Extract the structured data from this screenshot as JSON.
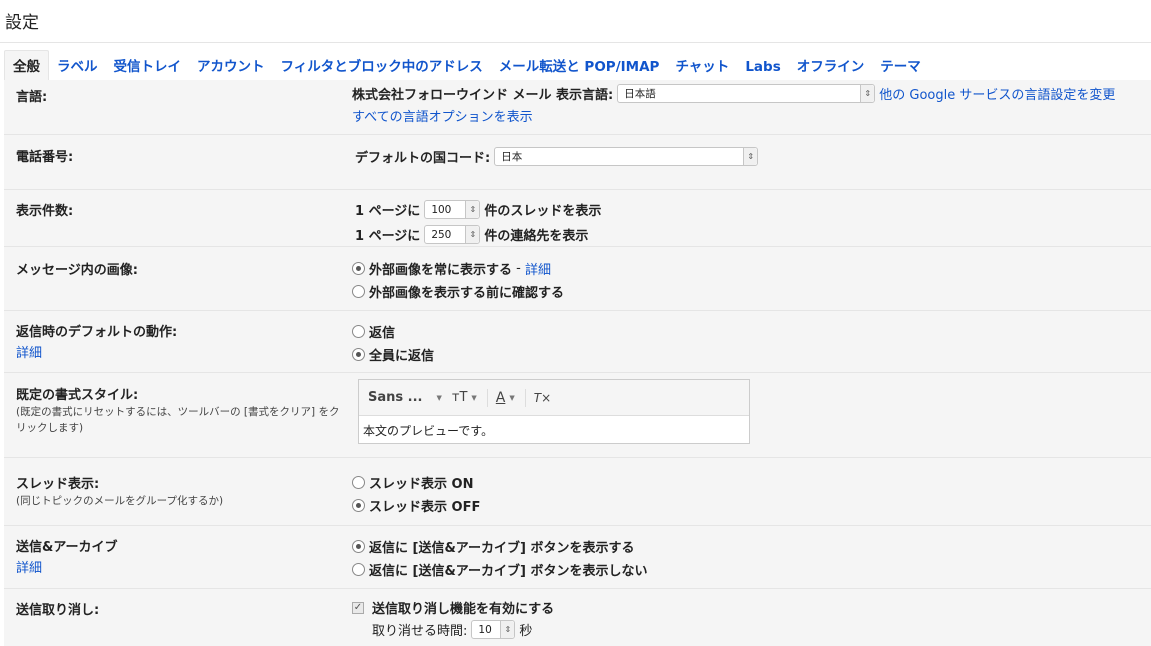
{
  "page_title": "設定",
  "tabs": [
    "全般",
    "ラベル",
    "受信トレイ",
    "アカウント",
    "フィルタとブロック中のアドレス",
    "メール転送と POP/IMAP",
    "チャット",
    "Labs",
    "オフライン",
    "テーマ"
  ],
  "language": {
    "label": "言語:",
    "prefix": "株式会社フォローウインド メール 表示言語:",
    "selected": "日本語",
    "other_link": "他の Google サービスの言語設定を変更",
    "all_options_link": "すべての言語オプションを表示"
  },
  "phone": {
    "label": "電話番号:",
    "prefix": "デフォルトの国コード:",
    "selected": "日本"
  },
  "display_count": {
    "label": "表示件数:",
    "threads_prefix": "1 ページに",
    "threads_value": "100",
    "threads_suffix": "件のスレッドを表示",
    "contacts_prefix": "1 ページに",
    "contacts_value": "250",
    "contacts_suffix": "件の連絡先を表示"
  },
  "images": {
    "label": "メッセージ内の画像:",
    "option_always": "外部画像を常に表示する",
    "separator": " - ",
    "detail_link": "詳細",
    "option_ask": "外部画像を表示する前に確認する"
  },
  "reply": {
    "label": "返信時のデフォルトの動作:",
    "detail_link": "詳細",
    "option_reply": "返信",
    "option_reply_all": "全員に返信"
  },
  "text_style": {
    "label": "既定の書式スタイル:",
    "note": "(既定の書式にリセットするには、ツールバーの [書式をクリア] をクリックします)",
    "font_name": "Sans ...",
    "size_icon_text": "ᴛT",
    "color_icon_text": "A",
    "clear_icon_text": "T×",
    "preview": "本文のプレビューです。"
  },
  "threads": {
    "label": "スレッド表示:",
    "note": "(同じトピックのメールをグループ化するか)",
    "option_on": "スレッド表示 ON",
    "option_off": "スレッド表示 OFF"
  },
  "send_archive": {
    "label": "送信&アーカイブ",
    "detail_link": "詳細",
    "option_show": "返信に [送信&アーカイブ] ボタンを表示する",
    "option_hide": "返信に [送信&アーカイブ] ボタンを表示しない"
  },
  "undo_send": {
    "label": "送信取り消し:",
    "enable_label": "送信取り消し機能を有効にする",
    "period_label": "取り消せる時間:",
    "period_value": "10",
    "period_unit": "秒"
  },
  "state": {
    "images_always": true,
    "reply_all": true,
    "threads_off": true,
    "send_archive_show": true,
    "undo_enabled": true
  },
  "colors": {
    "link": "#1155cc",
    "panel_bg": "#f5f5f5",
    "border": "#e5e5e5"
  }
}
